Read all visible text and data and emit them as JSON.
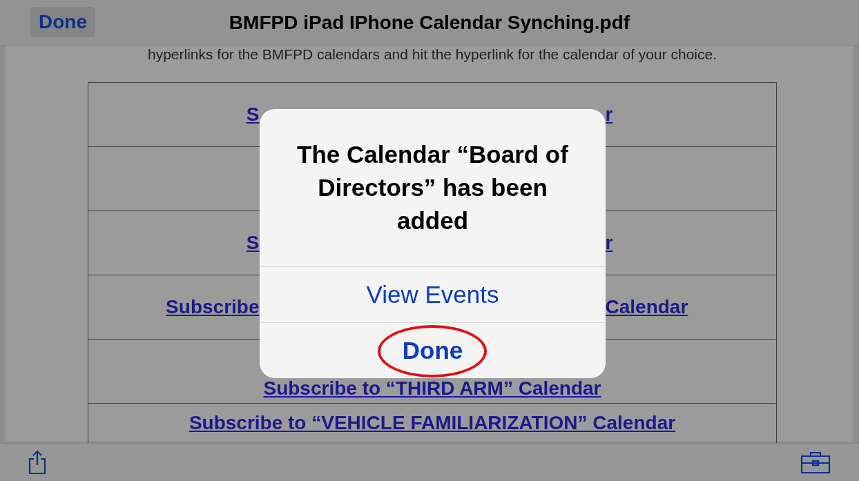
{
  "nav_bar": {
    "done_button": "Done",
    "title": "BMFPD iPad IPhone Calendar Synching.pdf"
  },
  "document": {
    "intro_line": "hyperlinks for the BMFPD calendars and hit the hyperlink for the calendar of your choice.",
    "rows": [
      {
        "left": "S",
        "right": "r"
      },
      {},
      {
        "left": "S",
        "right": "r"
      },
      {
        "left": "Subscribe",
        "right": "Calendar"
      },
      {
        "text": "Subscribe to “THIRD ARM” Calendar"
      },
      {
        "text": "Subscribe to “VEHICLE FAMILIARIZATION” Calendar"
      }
    ]
  },
  "alert": {
    "message": "The Calendar “Board of Directors” has been added",
    "buttons": [
      {
        "label": "View Events",
        "highlighted": false
      },
      {
        "label": "Done",
        "highlighted": true
      }
    ]
  }
}
